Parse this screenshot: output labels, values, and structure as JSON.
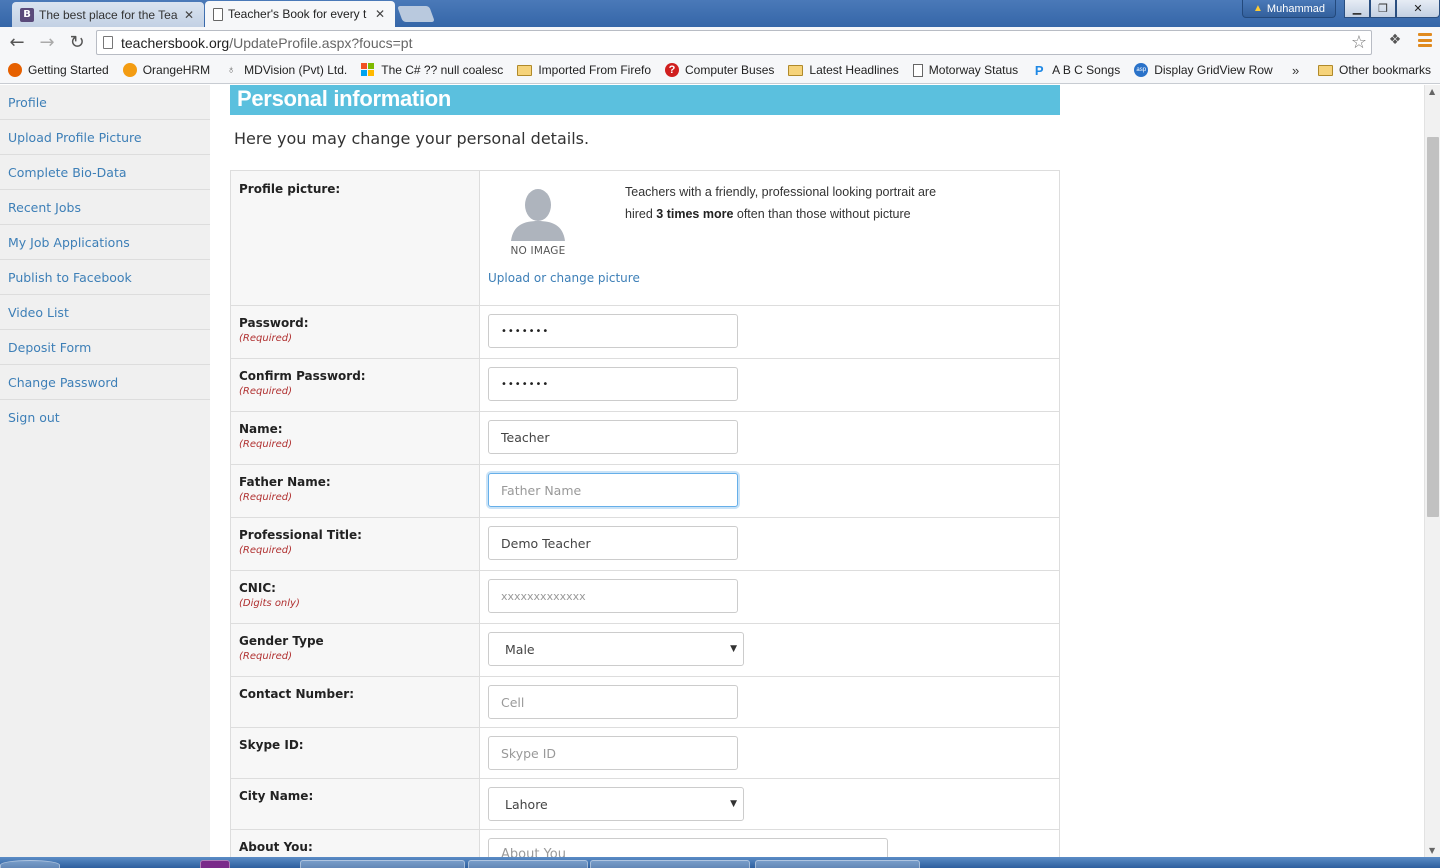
{
  "browser": {
    "tabs": [
      {
        "title": "The best place for the Tea",
        "favicon": "B",
        "active": false
      },
      {
        "title": "Teacher's Book for every t",
        "favicon": "doc",
        "active": true
      }
    ],
    "user_name": "Muhammad",
    "url_host": "teachersbook.org",
    "url_path": "/UpdateProfile.aspx?foucs=pt",
    "bookmarks": [
      {
        "label": "Getting Started",
        "icon": "firefox-icon"
      },
      {
        "label": "OrangeHRM",
        "icon": "orange-icon"
      },
      {
        "label": "MDVision (Pvt) Ltd.",
        "icon": "mdvision-icon"
      },
      {
        "label": "The C# ?? null coalesc",
        "icon": "microsoft-icon"
      },
      {
        "label": "Imported From Firefo",
        "icon": "folder-icon"
      },
      {
        "label": "Computer Buses",
        "icon": "question-icon"
      },
      {
        "label": "Latest Headlines",
        "icon": "folder-icon"
      },
      {
        "label": "Motorway Status",
        "icon": "page-icon"
      },
      {
        "label": "A B C Songs",
        "icon": "p-icon"
      },
      {
        "label": "Display GridView Row",
        "icon": "asp-icon"
      }
    ],
    "overflow": "»",
    "other_bookmarks": "Other bookmarks"
  },
  "sidebar": {
    "items": [
      {
        "label": "Profile"
      },
      {
        "label": "Upload Profile Picture"
      },
      {
        "label": "Complete Bio-Data"
      },
      {
        "label": "Recent Jobs"
      },
      {
        "label": "My Job Applications"
      },
      {
        "label": "Publish to Facebook"
      },
      {
        "label": "Video List"
      },
      {
        "label": "Deposit Form"
      },
      {
        "label": "Change Password"
      },
      {
        "label": "Sign out"
      }
    ]
  },
  "main": {
    "header": "Personal information",
    "description": "Here you may change your personal details.",
    "profile_picture": {
      "label": "Profile picture:",
      "no_image": "NO IMAGE",
      "tip_part1": "Teachers with a friendly, professional looking portrait are hired ",
      "tip_bold": "3 times more",
      "tip_part2": " often than those without picture",
      "upload_link": "Upload or change picture"
    },
    "required_text": "(Required)",
    "digits_only_text": "(Digits only)",
    "fields": {
      "password": {
        "label": "Password:",
        "value": "•••••••"
      },
      "confirm_password": {
        "label": "Confirm Password:",
        "value": "•••••••"
      },
      "name": {
        "label": "Name:",
        "value": "Teacher"
      },
      "father_name": {
        "label": "Father Name:",
        "placeholder": "Father Name"
      },
      "professional_title": {
        "label": "Professional Title:",
        "value": "Demo Teacher"
      },
      "cnic": {
        "label": "CNIC:",
        "placeholder": "xxxxxxxxxxxxx"
      },
      "gender": {
        "label": "Gender Type",
        "selected": "Male"
      },
      "contact_number": {
        "label": "Contact Number:",
        "placeholder": "Cell"
      },
      "skype_id": {
        "label": "Skype ID:",
        "placeholder": "Skype ID"
      },
      "city": {
        "label": "City Name:",
        "selected": "Lahore"
      },
      "about_you": {
        "label": "About You:",
        "placeholder": "About You"
      }
    }
  }
}
